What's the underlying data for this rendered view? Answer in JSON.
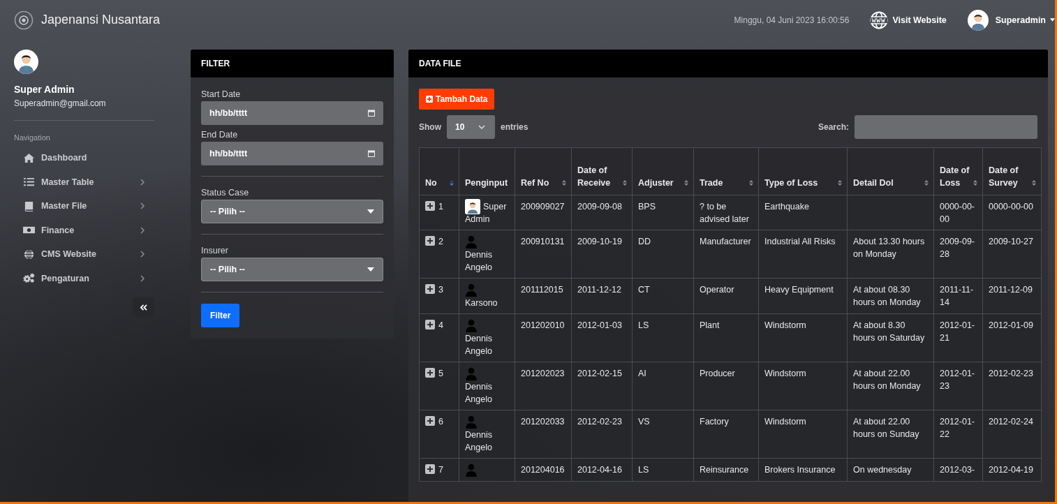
{
  "brand": {
    "title": "Japenansi Nusantara"
  },
  "topbar": {
    "datetime": "Minggu, 04 Juni 2023 16:00:56",
    "visit_link": "Visit Website",
    "user": "Superadmin"
  },
  "profile": {
    "name": "Super Admin",
    "email": "Superadmin@gmail.com"
  },
  "navigation": {
    "heading": "Navigation",
    "items": [
      {
        "label": "Dashboard",
        "kind": "home",
        "has_submenu": false
      },
      {
        "label": "Master Table",
        "kind": "list",
        "has_submenu": true
      },
      {
        "label": "Master File",
        "kind": "book",
        "has_submenu": true
      },
      {
        "label": "Finance",
        "kind": "money",
        "has_submenu": true
      },
      {
        "label": "CMS Website",
        "kind": "globe",
        "has_submenu": true
      },
      {
        "label": "Pengaturan",
        "kind": "gears",
        "has_submenu": true
      }
    ]
  },
  "filter": {
    "title": "FILTER",
    "start_date": {
      "label": "Start Date",
      "value": "hh/bb/tttt"
    },
    "end_date": {
      "label": "End Date",
      "value": "hh/bb/tttt"
    },
    "status_case": {
      "label": "Status Case",
      "value": "-- Pilih --"
    },
    "insurer": {
      "label": "Insurer",
      "value": "-- Pilih --"
    },
    "button": "Filter"
  },
  "data_file": {
    "title": "DATA FILE",
    "add_button": "Tambah Data",
    "show_label": "Show",
    "page_size": "10",
    "entries_label": "entries",
    "search_label": "Search:",
    "table": {
      "columns": [
        {
          "label": "No",
          "sortable": true,
          "sorted": true
        },
        {
          "label": "Penginput",
          "sortable": false,
          "sorted": false
        },
        {
          "label": "Ref No",
          "sortable": true,
          "sorted": false
        },
        {
          "label": "Date of Receive",
          "sortable": true,
          "sorted": false
        },
        {
          "label": "Adjuster",
          "sortable": true,
          "sorted": false
        },
        {
          "label": "Trade",
          "sortable": true,
          "sorted": false
        },
        {
          "label": "Type of Loss",
          "sortable": true,
          "sorted": false
        },
        {
          "label": "Detail Dol",
          "sortable": true,
          "sorted": false
        },
        {
          "label": "Date of Loss",
          "sortable": true,
          "sorted": false
        },
        {
          "label": "Date of Survey",
          "sortable": true,
          "sorted": false
        }
      ],
      "rows": [
        {
          "no": "1",
          "kind": "photo",
          "penginput": "Super Admin",
          "ref_no": "200909027",
          "date_of_receive": "2009-09-08",
          "adjuster": "BPS",
          "trade": "? to be advised later",
          "type_of_loss": "Earthquake",
          "date_of_loss": "0000-00-00",
          "date_of_survey": "0000-00-00"
        },
        {
          "no": "2",
          "kind": "silhouette",
          "penginput": "Dennis Angelo",
          "ref_no": "200910131",
          "date_of_receive": "2009-10-19",
          "adjuster": "DD",
          "trade": "Manufacturer",
          "type_of_loss": "Industrial All Risks",
          "detail_dol": "About 13.30 hours on Monday",
          "date_of_loss": "2009-09-28",
          "date_of_survey": "2009-10-27"
        },
        {
          "no": "3",
          "kind": "silhouette",
          "penginput": "Karsono",
          "ref_no": "201112015",
          "date_of_receive": "2011-12-12",
          "adjuster": "CT",
          "trade": "Operator",
          "type_of_loss": "Heavy Equipment",
          "detail_dol": "At about 08.30 hours on Monday",
          "date_of_loss": "2011-11-14",
          "date_of_survey": "2011-12-09"
        },
        {
          "no": "4",
          "kind": "silhouette",
          "penginput": "Dennis Angelo",
          "ref_no": "201202010",
          "date_of_receive": "2012-01-03",
          "adjuster": "LS",
          "trade": "Plant",
          "type_of_loss": "Windstorm",
          "detail_dol": "At about 8.30 hours on Saturday",
          "date_of_loss": "2012-01-21",
          "date_of_survey": "2012-01-09"
        },
        {
          "no": "5",
          "kind": "silhouette",
          "penginput": "Dennis Angelo",
          "ref_no": "201202023",
          "date_of_receive": "2012-02-15",
          "adjuster": "AI",
          "trade": "Producer",
          "type_of_loss": "Windstorm",
          "detail_dol": "At about 22.00 hours on Monday",
          "date_of_loss": "2012-01-23",
          "date_of_survey": "2012-02-23"
        },
        {
          "no": "6",
          "kind": "silhouette",
          "penginput": "Dennis Angelo",
          "ref_no": "201202033",
          "date_of_receive": "2012-02-23",
          "adjuster": "VS",
          "trade": "Factory",
          "type_of_loss": "Windstorm",
          "detail_dol": "At about 22.00 hours on Sunday",
          "date_of_loss": "2012-01-22",
          "date_of_survey": "2012-02-24"
        },
        {
          "no": "7",
          "kind": "silhouette",
          "ref_no": "201204016",
          "date_of_receive": "2012-04-16",
          "adjuster": "LS",
          "trade": "Reinsurance",
          "type_of_loss": "Brokers Insurance",
          "detail_dol": "On wednesday",
          "date_of_loss": "2012-03-",
          "date_of_survey": "2012-04-19"
        }
      ]
    }
  }
}
